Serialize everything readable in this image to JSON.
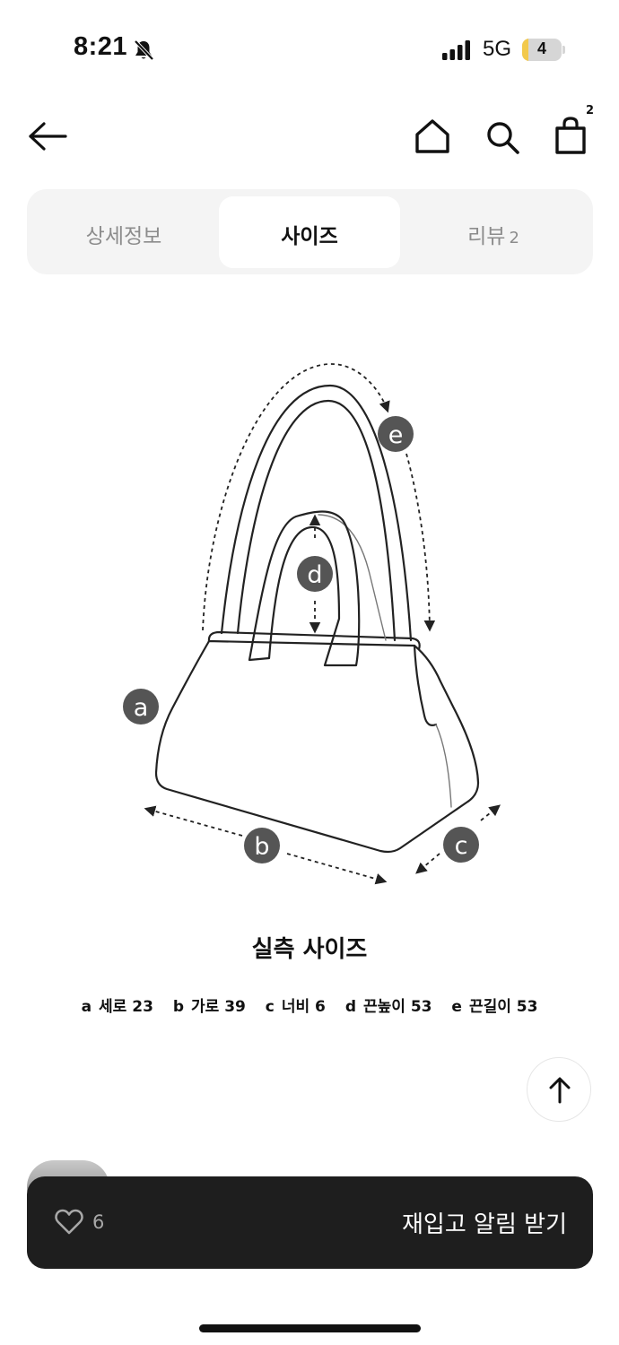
{
  "status_bar": {
    "time": "8:21",
    "network": "5G",
    "battery": "4",
    "battery_level_percent": 4
  },
  "header": {
    "cart_count": "2"
  },
  "tabs": [
    {
      "label": "상세정보"
    },
    {
      "label": "사이즈"
    },
    {
      "label": "리뷰",
      "count": "2"
    }
  ],
  "diagram": {
    "labels": [
      "a",
      "b",
      "c",
      "d",
      "e"
    ]
  },
  "size_section": {
    "title": "실측 사이즈",
    "measurements": [
      {
        "key": "a",
        "text": "세로 23"
      },
      {
        "key": "b",
        "text": "가로 39"
      },
      {
        "key": "c",
        "text": "너비 6"
      },
      {
        "key": "d",
        "text": "끈높이 53"
      },
      {
        "key": "e",
        "text": "끈길이 53"
      }
    ]
  },
  "bottom_bar": {
    "like_count": "6",
    "action_label": "재입고 알림 받기"
  },
  "colors": {
    "bottom_bar": "#1e1e1e",
    "tab_background": "#f4f4f4",
    "label_circle": "#555555"
  }
}
